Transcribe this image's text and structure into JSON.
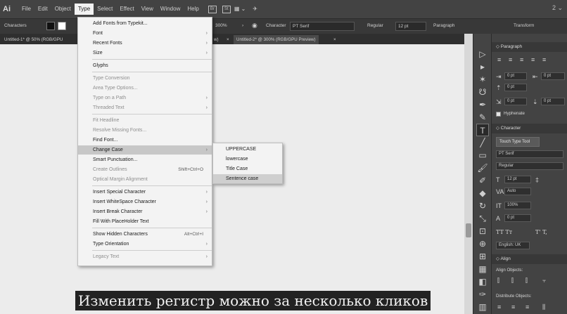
{
  "menubar": {
    "logo": "Ai",
    "items": [
      "File",
      "Edit",
      "Object",
      "Type",
      "Select",
      "Effect",
      "View",
      "Window",
      "Help"
    ],
    "icons": [
      "Br",
      "St",
      "▦ ⌄",
      "✈"
    ],
    "right": "2 ⌄"
  },
  "control": {
    "label": "Characters",
    "zoom": "300%",
    "character_label": "Character",
    "font": "PT Serif",
    "style": "Regular",
    "size": "12 pt",
    "paragraph_label": "Paragraph",
    "transform_label": "Transform"
  },
  "tabs": {
    "tab1": "Untitled-1* @ 50% (RGB/GPU",
    "tab1_rest": "w)",
    "tab2": "Untitled-2* @ 300% (RGB/GPU Preview)",
    "close": "×"
  },
  "type_menu": {
    "items": [
      {
        "label": "Add Fonts from Typekit...",
        "disabled": false
      },
      {
        "label": "Font",
        "disabled": false,
        "arrow": "›"
      },
      {
        "label": "Recent Fonts",
        "disabled": false,
        "arrow": "›"
      },
      {
        "label": "Size",
        "disabled": false,
        "arrow": "›"
      },
      {
        "label": "Glyphs",
        "disabled": false
      },
      {
        "label": "Type Conversion",
        "disabled": true
      },
      {
        "label": "Area Type Options...",
        "disabled": true
      },
      {
        "label": "Type on a Path",
        "disabled": true,
        "arrow": "›"
      },
      {
        "label": "Threaded Text",
        "disabled": true,
        "arrow": "›"
      },
      {
        "label": "Fit Headline",
        "disabled": true
      },
      {
        "label": "Resolve Missing Fonts...",
        "disabled": true
      },
      {
        "label": "Find Font...",
        "disabled": false
      },
      {
        "label": "Change Case",
        "disabled": false,
        "arrow": "›"
      },
      {
        "label": "Smart Punctuation...",
        "disabled": false
      },
      {
        "label": "Create Outlines",
        "disabled": true,
        "shortcut": "Shift+Ctrl+O"
      },
      {
        "label": "Optical Margin Alignment",
        "disabled": true
      },
      {
        "label": "Insert Special Character",
        "disabled": false,
        "arrow": "›"
      },
      {
        "label": "Insert WhiteSpace Character",
        "disabled": false,
        "arrow": "›"
      },
      {
        "label": "Insert Break Character",
        "disabled": false,
        "arrow": "›"
      },
      {
        "label": "Fill With PlaceHolder Text",
        "disabled": false
      },
      {
        "label": "Show Hidden Characters",
        "disabled": false,
        "shortcut": "Alt+Ctrl+I"
      },
      {
        "label": "Type Orientation",
        "disabled": false,
        "arrow": "›"
      },
      {
        "label": "Legacy Text",
        "disabled": true,
        "arrow": "›"
      }
    ]
  },
  "change_case_menu": {
    "items": [
      "UPPERCASE",
      "lowercase",
      "Title Case",
      "Sentence case"
    ]
  },
  "panels": {
    "paragraph": {
      "title": "◇ Paragraph",
      "indent_left": "0 pt",
      "indent_right": "0 pt",
      "first_line": "0 pt",
      "space_before": "0 pt",
      "space_after": "0 pt",
      "hyphenate": "Hyphenate"
    },
    "character": {
      "title": "◇ Character",
      "touch_tool": "Touch Type Tool",
      "font": "PT Serif",
      "style": "Regular",
      "size": "12 pt",
      "leading": "Auto",
      "vscale": "100%",
      "tracking": "0 pt",
      "tt": "TT  Tт",
      "tsup": "T'  T,",
      "language": "English: UK"
    },
    "align": {
      "title": "◇ Align",
      "align_objects": "Align Objects:",
      "distribute_objects": "Distribute Objects:"
    }
  },
  "caption": "Изменить регистр можно за несколько кликов"
}
